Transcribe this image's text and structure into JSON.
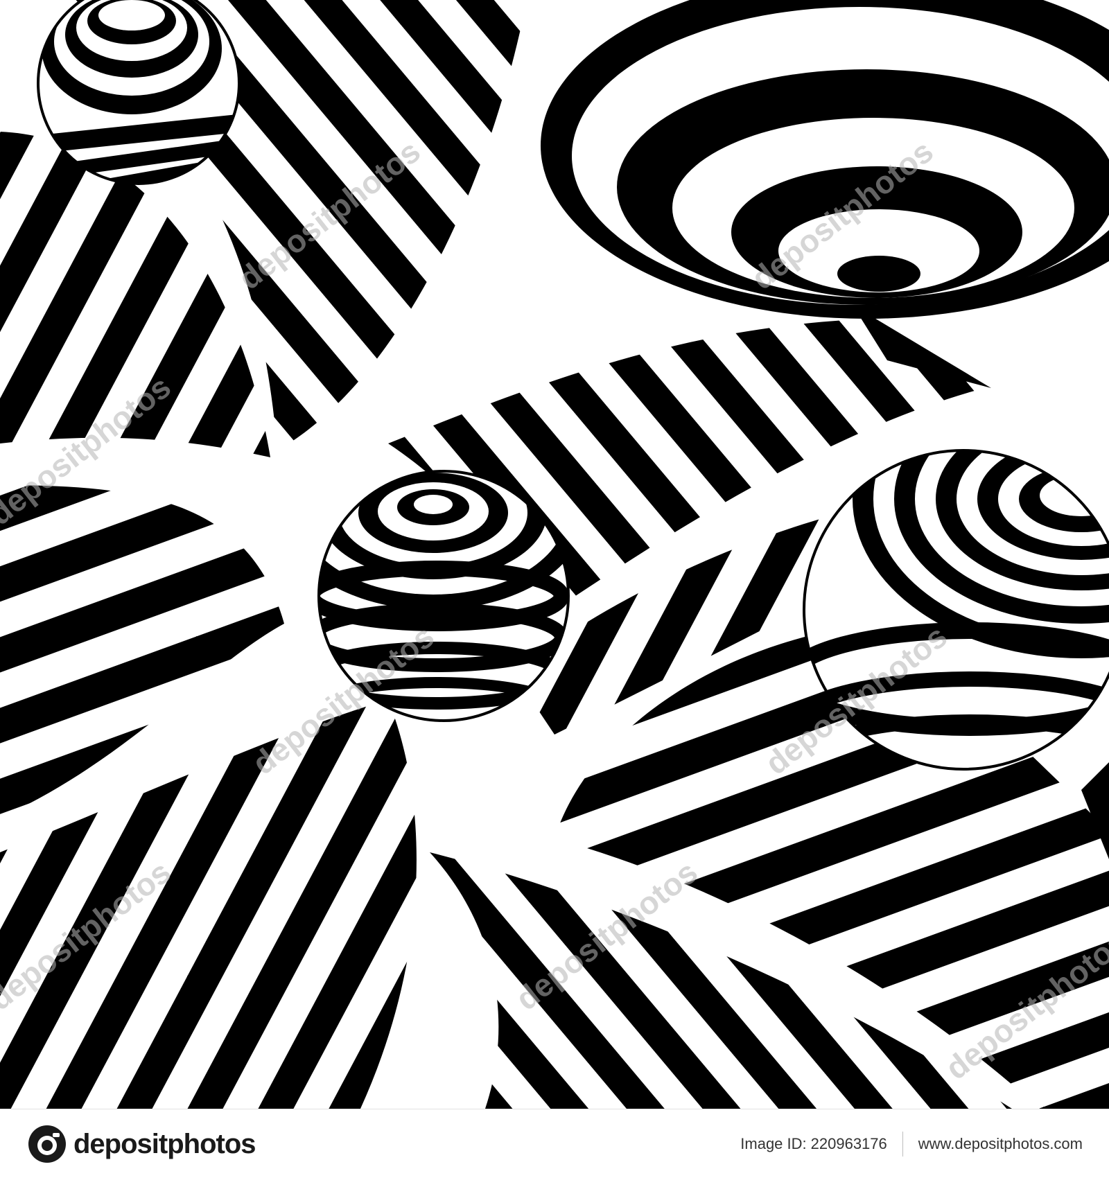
{
  "artwork": {
    "style": "black-and-white op-art striped vortex with striped spheres",
    "colors": {
      "ink": "#000000",
      "paper": "#ffffff"
    },
    "watermark_text": "depositphotos"
  },
  "footer": {
    "logo_text": "depositphotos",
    "logo_icon": "depositphotos-camera-icon",
    "image_id_label": "Image ID:",
    "image_id_value": "220963176",
    "url": "www.depositphotos.com"
  }
}
